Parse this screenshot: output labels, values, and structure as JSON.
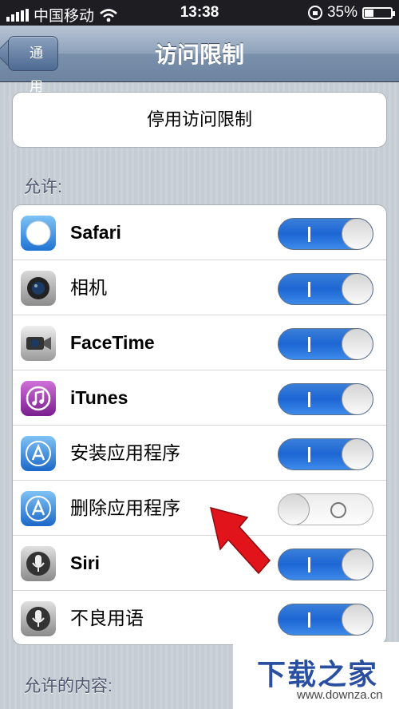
{
  "status_bar": {
    "carrier": "中国移动",
    "time": "13:38",
    "battery": "35%",
    "battery_level": 0.35
  },
  "nav": {
    "back_label": "通用",
    "title": "访问限制"
  },
  "disable_button_label": "停用访问限制",
  "section_allow": "允许:",
  "section_allowed_content": "允许的内容:",
  "rows": [
    {
      "label": "Safari",
      "icon": "safari-icon",
      "bold": true,
      "on": true,
      "color": "#2b86e6"
    },
    {
      "label": "相机",
      "icon": "camera-icon",
      "bold": false,
      "on": true,
      "color": "#3a3a3a"
    },
    {
      "label": "FaceTime",
      "icon": "facetime-icon",
      "bold": true,
      "on": true,
      "color": "#9aa0a6"
    },
    {
      "label": "iTunes",
      "icon": "itunes-icon",
      "bold": true,
      "on": true,
      "color": "#9b2fae"
    },
    {
      "label": "安装应用程序",
      "icon": "app-store-icon",
      "bold": false,
      "on": true,
      "color": "#2a7fe0"
    },
    {
      "label": "删除应用程序",
      "icon": "app-store-icon",
      "bold": false,
      "on": false,
      "color": "#2a7fe0"
    },
    {
      "label": "Siri",
      "icon": "siri-microphone-icon",
      "bold": true,
      "on": true,
      "color": "#555"
    },
    {
      "label": "不良用语",
      "icon": "siri-microphone-icon",
      "bold": false,
      "on": true,
      "color": "#555"
    }
  ],
  "watermark": {
    "title": "下载之家",
    "url": "www.downza.cn"
  },
  "annotation_color": "#e1141b"
}
